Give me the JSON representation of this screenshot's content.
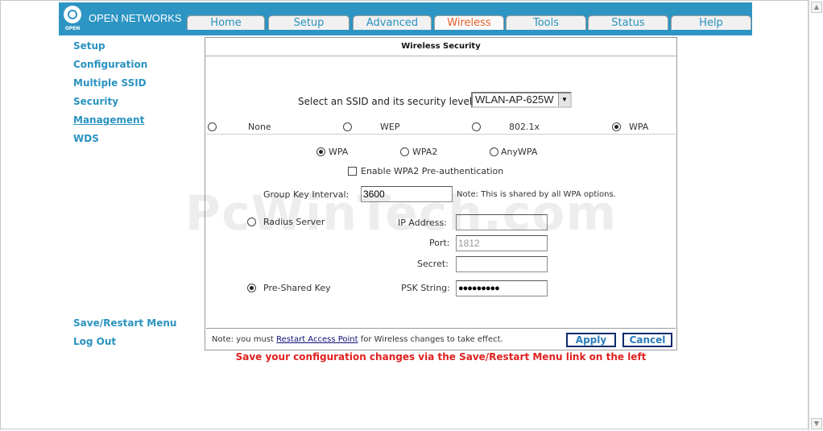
{
  "brand": {
    "name": "OPEN NETWORKS",
    "sub": "OPEN"
  },
  "tabs": [
    {
      "label": "Home"
    },
    {
      "label": "Setup"
    },
    {
      "label": "Advanced"
    },
    {
      "label": "Wireless",
      "active": true
    },
    {
      "label": "Tools"
    },
    {
      "label": "Status"
    },
    {
      "label": "Help"
    }
  ],
  "sidebar": {
    "items": [
      {
        "label": "Setup"
      },
      {
        "label": "Configuration"
      },
      {
        "label": "Multiple SSID"
      },
      {
        "label": "Security"
      },
      {
        "label": "Management"
      },
      {
        "label": "WDS"
      }
    ],
    "bottom": [
      {
        "label": "Save/Restart Menu"
      },
      {
        "label": "Log Out"
      }
    ]
  },
  "panel": {
    "title": "Wireless Security",
    "ssid_label": "Select an SSID and its security level:",
    "ssid_value": "WLAN-AP-625W",
    "levels": [
      {
        "label": "None",
        "checked": false
      },
      {
        "label": "WEP",
        "checked": false
      },
      {
        "label": "802.1x",
        "checked": false
      },
      {
        "label": "WPA",
        "checked": true
      }
    ],
    "wpa_modes": [
      {
        "label": "WPA",
        "checked": true
      },
      {
        "label": "WPA2",
        "checked": false
      },
      {
        "label": "AnyWPA",
        "checked": false
      }
    ],
    "preauth_label": "Enable WPA2 Pre-authentication",
    "group_key_label": "Group Key Interval:",
    "group_key_value": "3600",
    "group_key_note": "Note: This is shared by all WPA options.",
    "radius_label": "Radius Server",
    "ip_label": "IP Address:",
    "ip_value": "",
    "port_label": "Port:",
    "port_value": "1812",
    "secret_label": "Secret:",
    "secret_value": "",
    "psk_label": "Pre-Shared Key",
    "psk_string_label": "PSK String:",
    "psk_string_value": "●●●●●●●●●",
    "note_prefix": "Note: you must ",
    "note_link": "Restart Access Point",
    "note_suffix": " for Wireless changes to take effect.",
    "apply_label": "Apply",
    "cancel_label": "Cancel"
  },
  "warning": "Save your configuration changes via the Save/Restart Menu link on the left",
  "watermark": "PcWinTech.com",
  "colors": {
    "brand_blue": "#2d95c3",
    "active_tab": "#e8602c",
    "warning": "#e02020"
  }
}
